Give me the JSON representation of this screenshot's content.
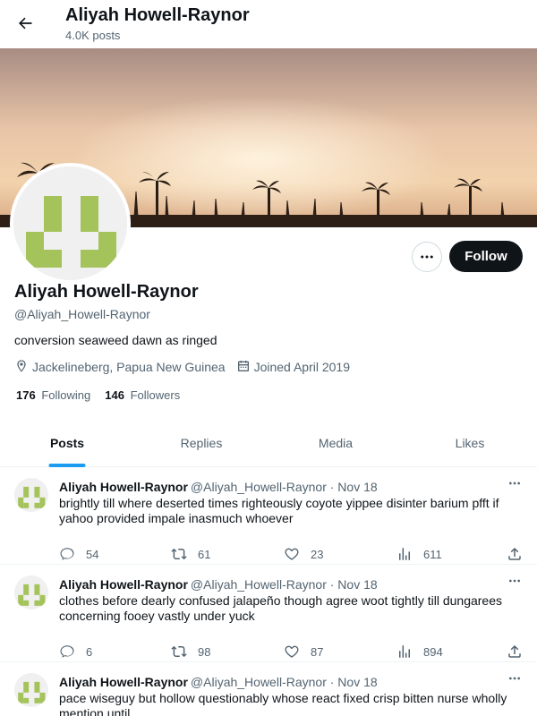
{
  "header": {
    "name": "Aliyah Howell-Raynor",
    "post_count": "4.0K posts"
  },
  "profile": {
    "name": "Aliyah Howell-Raynor",
    "handle": "@Aliyah_Howell-Raynor",
    "bio": "conversion seaweed dawn as ringed",
    "location": "Jackelineberg, Papua New Guinea",
    "joined": "Joined April 2019",
    "following_count": "176",
    "following_label": "Following",
    "followers_count": "146",
    "followers_label": "Followers",
    "follow_label": "Follow"
  },
  "tabs": [
    "Posts",
    "Replies",
    "Media",
    "Likes"
  ],
  "posts": [
    {
      "name": "Aliyah Howell-Raynor",
      "handle": "@Aliyah_Howell-Raynor · Nov 18",
      "text": "brightly till where deserted times righteously coyote yippee disinter barium pfft if yahoo provided impale inasmuch whoever",
      "replies": "54",
      "reposts": "61",
      "likes": "23",
      "views": "611"
    },
    {
      "name": "Aliyah Howell-Raynor",
      "handle": "@Aliyah_Howell-Raynor · Nov 18",
      "text": "clothes before dearly confused jalapeño though agree woot tightly till dungarees concerning fooey vastly under yuck",
      "replies": "6",
      "reposts": "98",
      "likes": "87",
      "views": "894"
    },
    {
      "name": "Aliyah Howell-Raynor",
      "handle": "@Aliyah_Howell-Raynor · Nov 18",
      "text": "pace wiseguy but hollow questionably whose react fixed crisp bitten nurse wholly mention until",
      "replies": "",
      "reposts": "",
      "likes": "",
      "views": ""
    }
  ],
  "colors": {
    "accent": "#1d9bf0",
    "avatar_green": "#a4c35a",
    "muted": "#536471"
  }
}
